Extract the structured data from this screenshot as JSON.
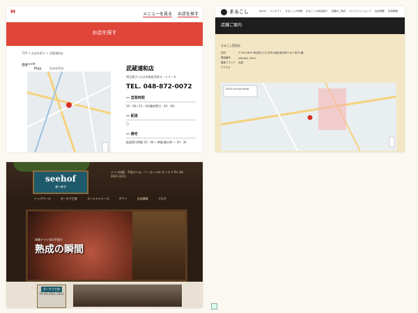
{
  "panel1": {
    "logo": "M",
    "logo_sub": "",
    "menu_open": "メニューを見る",
    "menu_find": "お店を探す",
    "banner_title": "お店を探す",
    "banner_sub": "",
    "breadcrumb": "TOP > お店を探す > 武蔵浦和店",
    "result_label": "検索結果",
    "map_tab_map": "Map",
    "map_tab_sat": "Satellite",
    "store_name": "武蔵浦和店",
    "address": "埼玉県さいたま市南区別所４－２３－８",
    "tel": "TEL. 048-872-0072",
    "hours_title": "営業時間",
    "hours_value": "10：00～21：00(最終受付：20：30)",
    "delivery_title": "配達",
    "delivery_value": "〇",
    "notes_title": "備考",
    "notes_value": "配達受付時間 10：00～ 時間 最大時 ～ 20：30"
  },
  "panel2": {
    "logo": "まるこし",
    "nav": [
      "Home",
      "コンセプト",
      "まるこしの特徴",
      "まるこしの商品紹介",
      "店舗のご案内",
      "オンラインショップ",
      "会社概要",
      "採用情報"
    ],
    "bar_title": "店舗ご案内",
    "store_heading": "まるこし西宮店",
    "rows": [
      {
        "k": "住所",
        "v": "〒330-0854 埼玉県さいたま市大宮区桜木町1-6-2 地下1階"
      },
      {
        "k": "電話番号",
        "v": "048-641-1829"
      },
      {
        "k": "取扱ブランド",
        "v": "丸越"
      },
      {
        "k": "アクセス",
        "v": ""
      }
    ],
    "map_badge": "SOGO Omiya Store"
  },
  "panel3": {
    "sign_title": "seehof",
    "sign_sub": "ゼーホフ",
    "shop_info": "ドイツ料理・手造りハム・ソーセージの ゼーホフ Tel. 04-2921-3311",
    "menu": [
      "トップページ",
      "ゼーホフ工房",
      "ゴールドシリーズ",
      "ギフト",
      "お店情報",
      "ブログ"
    ],
    "catch_small": "本格ドイツ式の手造り",
    "catch_big": "熟成の瞬間",
    "badge_title": "ゼーホフ工房",
    "badge_text": "Tel 04-2921-3311"
  }
}
